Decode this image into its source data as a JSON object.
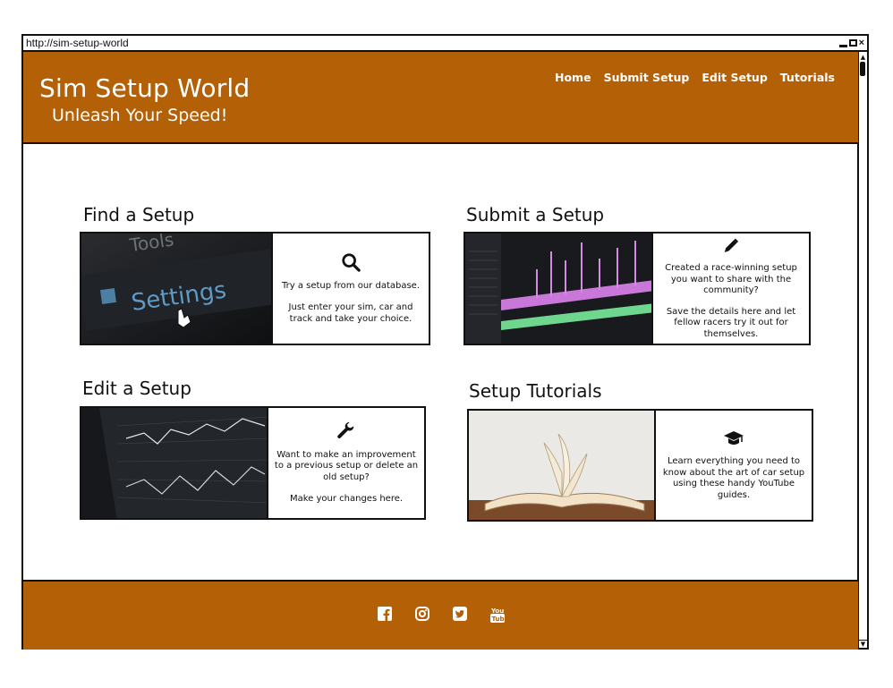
{
  "browser": {
    "url": "http://sim-setup-world"
  },
  "header": {
    "title": "Sim Setup World",
    "tagline": "Unleash Your Speed!",
    "nav": [
      "Home",
      "Submit Setup",
      "Edit Setup",
      "Tutorials"
    ]
  },
  "cards": [
    {
      "heading": "Find a Setup",
      "icon": "search-icon",
      "lines": [
        "Try a setup from our database.",
        "Just enter your sim, car and track and take your choice."
      ],
      "image_text": [
        "Tools",
        "Settings"
      ]
    },
    {
      "heading": "Submit a Setup",
      "icon": "pencil-icon",
      "lines": [
        "Created a race-winning setup you want to share with the community?",
        "Save the details here and let fellow racers try it out for themselves."
      ]
    },
    {
      "heading": "Edit a Setup",
      "icon": "wrench-icon",
      "lines": [
        "Want to make an improvement to a previous setup or delete an old setup?",
        "Make your changes here."
      ]
    },
    {
      "heading": "Setup Tutorials",
      "icon": "graduation-cap-icon",
      "lines": [
        "Learn everything you need to know about the art of car setup using these handy YouTube guides."
      ]
    }
  ],
  "footer": {
    "social": [
      "facebook-icon",
      "instagram-icon",
      "twitter-icon",
      "youtube-icon"
    ]
  },
  "colors": {
    "brand": "#b36006"
  }
}
